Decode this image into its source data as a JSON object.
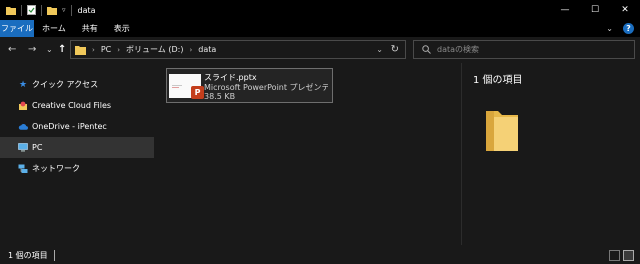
{
  "titlebar": {
    "title": "data",
    "controls": {
      "minimize": "—",
      "maximize": "☐",
      "close": "✕"
    }
  },
  "ribbon": {
    "tabs": [
      "ファイル",
      "ホーム",
      "共有",
      "表示"
    ],
    "expand_icon": "chevron-down-icon",
    "help_label": "?"
  },
  "nav": {
    "back": "←",
    "forward": "→",
    "recent": "⌄",
    "up": "↑"
  },
  "address": {
    "crumbs": [
      "PC",
      "ボリューム (D:)",
      "data"
    ],
    "refresh": "↻"
  },
  "search": {
    "placeholder": "dataの検索"
  },
  "sidebar": {
    "items": [
      {
        "label": "クイック アクセス",
        "icon": "star-icon"
      },
      {
        "label": "Creative Cloud Files",
        "icon": "creative-cloud-icon"
      },
      {
        "label": "OneDrive - iPentec",
        "icon": "cloud-icon"
      },
      {
        "label": "PC",
        "icon": "computer-icon"
      },
      {
        "label": "ネットワーク",
        "icon": "network-icon"
      }
    ]
  },
  "file": {
    "name": "スライド.pptx",
    "type": "Microsoft PowerPoint プレゼンテー...",
    "size": "38.5 KB",
    "badge": "P"
  },
  "preview": {
    "count_label": "1 個の項目"
  },
  "status": {
    "count_label": "1 個の項目"
  },
  "colors": {
    "accent": "#1a6dbf",
    "folder": "#f0c85a",
    "ppt": "#c43e1c",
    "background": "#191919"
  }
}
